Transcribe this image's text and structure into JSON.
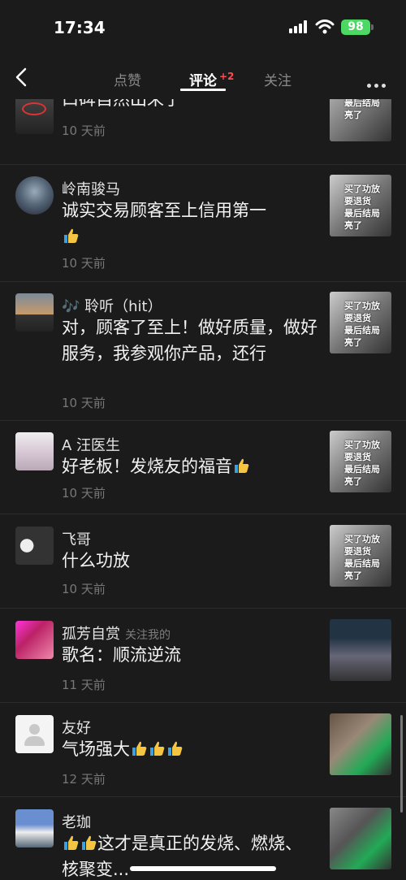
{
  "status_bar": {
    "time": "17:34",
    "battery": "98"
  },
  "nav": {
    "tabs": [
      "点赞",
      "评论",
      "关注"
    ],
    "comment_badge": "+2"
  },
  "comments": [
    {
      "name": "",
      "text": "口碑自然出来了",
      "date": "10 天前",
      "thumb_caption": "要退货\n最后结局\n亮了"
    },
    {
      "name": "岭南骏马",
      "text": "诚实交易顾客至上信用第一",
      "date": "10 天前",
      "thumb_caption": "买了功放\n要退货\n最后结局\n亮了"
    },
    {
      "name": "🎶 聆听（hit）",
      "text": "对，顾客了至上！做好质量，做好服务，我参观你产品，还行",
      "date": "10 天前",
      "thumb_caption": "买了功放\n要退货\n最后结局\n亮了"
    },
    {
      "name": "A 汪医生",
      "text": "好老板！发烧友的福音",
      "date": "10 天前",
      "thumb_caption": "买了功放\n要退货\n最后结局\n亮了"
    },
    {
      "name": "飞哥",
      "text": "什么功放",
      "date": "10 天前",
      "thumb_caption": "买了功放\n要退货\n最后结局\n亮了"
    },
    {
      "name": "孤芳自赏",
      "follow_tag": "关注我的",
      "text": "歌名：顺流逆流",
      "date": "11 天前",
      "thumb_caption": ""
    },
    {
      "name": "友好",
      "text": "气场强大",
      "date": "12 天前",
      "thumb_caption": ""
    },
    {
      "name": "老珈",
      "text": "这才是真正的发烧、燃烧、核聚变...",
      "date": "",
      "thumb_caption": ""
    }
  ]
}
